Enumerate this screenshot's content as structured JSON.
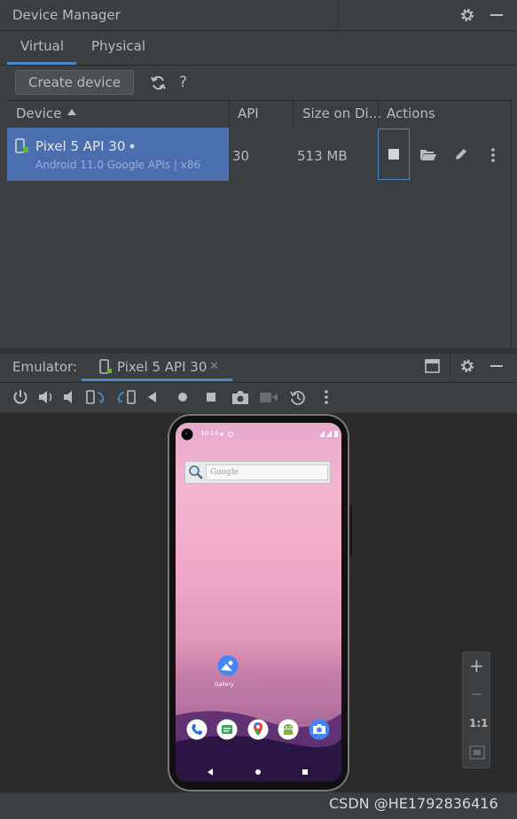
{
  "header": {
    "title": "Device Manager"
  },
  "tabs": [
    {
      "label": "Virtual",
      "active": true
    },
    {
      "label": "Physical",
      "active": false
    }
  ],
  "toolbar": {
    "create_label": "Create device",
    "help_label": "?"
  },
  "table": {
    "columns": [
      "Device",
      "API",
      "Size on Di...",
      "Actions"
    ],
    "rows": [
      {
        "name": "Pixel 5 API 30",
        "subtitle": "Android 11.0 Google APIs | x86",
        "api": "30",
        "size": "513 MB"
      }
    ]
  },
  "emulator": {
    "label": "Emulator:",
    "tab": "Pixel 5 API 30",
    "tab_close": "✕",
    "screen": {
      "time": "10:14",
      "search_placeholder": "Google",
      "gallery": "Gallery"
    },
    "zoom": {
      "plus": "+",
      "minus": "−",
      "one_to_one": "1:1"
    }
  },
  "watermark": "CSDN @HE1792836416",
  "colors": {
    "accent": "#4a88c7",
    "selection": "#4b6eaf",
    "background": "#3c3f41",
    "emulator_bg": "#2b2b2b"
  }
}
